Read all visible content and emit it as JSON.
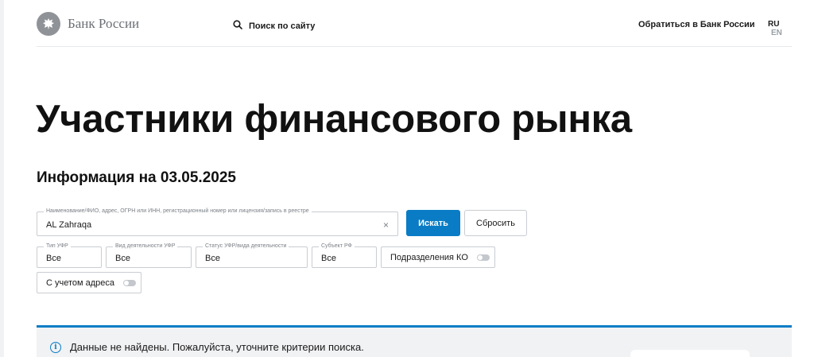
{
  "header": {
    "logo_text": "Банк России",
    "search_label": "Поиск по сайту",
    "contact_label": "Обратиться в Банк России",
    "lang_ru": "RU",
    "lang_en": "EN"
  },
  "page": {
    "title": "Участники финансового рынка",
    "info_date": "Информация на 03.05.2025"
  },
  "search_form": {
    "main_field": {
      "label": "Наименование/ФИО, адрес, ОГРН или ИНН, регистрационный номер или лицензия/запись в реестре",
      "value": "AL Zahraqa",
      "clear": "×"
    },
    "search_button": "Искать",
    "reset_button": "Сбросить",
    "filters": [
      {
        "label": "Тип УФР",
        "value": "Все"
      },
      {
        "label": "Вид деятельности УФР",
        "value": "Все"
      },
      {
        "label": "Статус УФР/вида деятельности",
        "value": "Все"
      },
      {
        "label": "Субъект РФ",
        "value": "Все"
      }
    ],
    "toggle_branches": {
      "label": "Подразделения КО",
      "on": false
    },
    "toggle_address": {
      "label": "С учетом адреса",
      "on": false
    }
  },
  "result": {
    "message": "Данные не найдены. Пожалуйста, уточните критерии поиска.",
    "info_icon": "i"
  },
  "colors": {
    "accent": "#0a7cc5",
    "panel_bg": "#f1f2f4",
    "border": "#c9cdd2"
  }
}
